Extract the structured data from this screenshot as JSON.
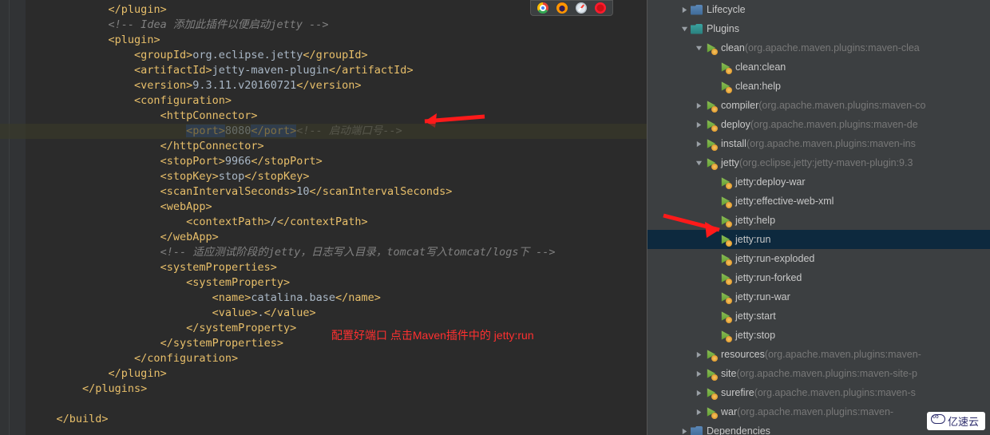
{
  "editor": {
    "highlight_line_index": 7,
    "lines": [
      {
        "indent": 3,
        "html": "<span class='tag'>&lt;/plugin&gt;</span>"
      },
      {
        "indent": 3,
        "html": "<span class='cmt'>&lt;!-- Idea 添加此插件以便启动jetty --&gt;</span>"
      },
      {
        "indent": 3,
        "html": "<span class='tag'>&lt;plugin&gt;</span>"
      },
      {
        "indent": 4,
        "html": "<span class='tag'>&lt;groupId&gt;</span><span class='val'>org.eclipse.jetty</span><span class='tag'>&lt;/groupId&gt;</span>"
      },
      {
        "indent": 4,
        "html": "<span class='tag'>&lt;artifactId&gt;</span><span class='val'>jetty-maven-plugin</span><span class='tag'>&lt;/artifactId&gt;</span>"
      },
      {
        "indent": 4,
        "html": "<span class='tag'>&lt;version&gt;</span><span class='val'>9.3.11.v20160721</span><span class='tag'>&lt;/version&gt;</span>"
      },
      {
        "indent": 4,
        "html": "<span class='tag'>&lt;configuration&gt;</span>"
      },
      {
        "indent": 5,
        "html": "<span class='tag'>&lt;httpConnector&gt;</span>"
      },
      {
        "indent": 6,
        "html": "<span class='sel'><span class='tag'>&lt;port&gt;</span></span><span class='val'>8080</span><span class='sel'><span class='tag'>&lt;/port&gt;</span></span><span class='cmt'>&lt;!-- 启动端口号--&gt;</span>",
        "caret": true
      },
      {
        "indent": 5,
        "html": "<span class='tag'>&lt;/httpConnector&gt;</span>"
      },
      {
        "indent": 5,
        "html": "<span class='tag'>&lt;stopPort&gt;</span><span class='val'>9966</span><span class='tag'>&lt;/stopPort&gt;</span>"
      },
      {
        "indent": 5,
        "html": "<span class='tag'>&lt;stopKey&gt;</span><span class='val'>stop</span><span class='tag'>&lt;/stopKey&gt;</span>"
      },
      {
        "indent": 5,
        "html": "<span class='tag'>&lt;scanIntervalSeconds&gt;</span><span class='val'>10</span><span class='tag'>&lt;/scanIntervalSeconds&gt;</span>"
      },
      {
        "indent": 5,
        "html": "<span class='tag'>&lt;webApp&gt;</span>"
      },
      {
        "indent": 6,
        "html": "<span class='tag'>&lt;contextPath&gt;</span><span class='val'>/</span><span class='tag'>&lt;/contextPath&gt;</span>"
      },
      {
        "indent": 5,
        "html": "<span class='tag'>&lt;/webApp&gt;</span>"
      },
      {
        "indent": 5,
        "html": "<span class='cmt'>&lt;!-- 适应测试阶段的jetty，日志写入目录，tomcat写入tomcat/logs下 --&gt;</span>"
      },
      {
        "indent": 5,
        "html": "<span class='tag'>&lt;systemProperties&gt;</span>"
      },
      {
        "indent": 6,
        "html": "<span class='tag'>&lt;systemProperty&gt;</span>"
      },
      {
        "indent": 7,
        "html": "<span class='tag'>&lt;name&gt;</span><span class='val'>catalina.base</span><span class='tag'>&lt;/name&gt;</span>"
      },
      {
        "indent": 7,
        "html": "<span class='tag'>&lt;value&gt;</span><span class='val'>.</span><span class='tag'>&lt;/value&gt;</span>"
      },
      {
        "indent": 6,
        "html": "<span class='tag'>&lt;/systemProperty&gt;</span>"
      },
      {
        "indent": 5,
        "html": "<span class='tag'>&lt;/systemProperties&gt;</span>"
      },
      {
        "indent": 4,
        "html": "<span class='tag'>&lt;/configuration&gt;</span>"
      },
      {
        "indent": 3,
        "html": "<span class='tag'>&lt;/plugin&gt;</span>"
      },
      {
        "indent": 2,
        "html": "<span class='tag'>&lt;/plugins&gt;</span>"
      },
      {
        "indent": 0,
        "html": ""
      },
      {
        "indent": 1,
        "html": "<span class='tag'>&lt;/build&gt;</span>"
      }
    ],
    "annotation_text": "配置好端口 点击Maven插件中的 jetty:run"
  },
  "browser_icons": [
    "chrome",
    "firefox",
    "safari",
    "opera"
  ],
  "maven": {
    "nodes": [
      {
        "depth": 2,
        "tw": "right",
        "icon": "folder",
        "label": "Lifecycle",
        "meta": ""
      },
      {
        "depth": 2,
        "tw": "down",
        "icon": "folderteal",
        "label": "Plugins",
        "meta": ""
      },
      {
        "depth": 3,
        "tw": "down",
        "icon": "run",
        "label": "clean",
        "meta": " (org.apache.maven.plugins:maven-clea"
      },
      {
        "depth": 4,
        "tw": "none",
        "icon": "run",
        "label": "clean:clean",
        "meta": ""
      },
      {
        "depth": 4,
        "tw": "none",
        "icon": "run",
        "label": "clean:help",
        "meta": ""
      },
      {
        "depth": 3,
        "tw": "right",
        "icon": "run",
        "label": "compiler",
        "meta": " (org.apache.maven.plugins:maven-co"
      },
      {
        "depth": 3,
        "tw": "right",
        "icon": "run",
        "label": "deploy",
        "meta": " (org.apache.maven.plugins:maven-de"
      },
      {
        "depth": 3,
        "tw": "right",
        "icon": "run",
        "label": "install",
        "meta": " (org.apache.maven.plugins:maven-ins"
      },
      {
        "depth": 3,
        "tw": "down",
        "icon": "run",
        "label": "jetty",
        "meta": " (org.eclipse.jetty:jetty-maven-plugin:9.3"
      },
      {
        "depth": 4,
        "tw": "none",
        "icon": "run",
        "label": "jetty:deploy-war",
        "meta": ""
      },
      {
        "depth": 4,
        "tw": "none",
        "icon": "run",
        "label": "jetty:effective-web-xml",
        "meta": ""
      },
      {
        "depth": 4,
        "tw": "none",
        "icon": "run",
        "label": "jetty:help",
        "meta": ""
      },
      {
        "depth": 4,
        "tw": "none",
        "icon": "run",
        "label": "jetty:run",
        "meta": "",
        "selected": true
      },
      {
        "depth": 4,
        "tw": "none",
        "icon": "run",
        "label": "jetty:run-exploded",
        "meta": ""
      },
      {
        "depth": 4,
        "tw": "none",
        "icon": "run",
        "label": "jetty:run-forked",
        "meta": ""
      },
      {
        "depth": 4,
        "tw": "none",
        "icon": "run",
        "label": "jetty:run-war",
        "meta": ""
      },
      {
        "depth": 4,
        "tw": "none",
        "icon": "run",
        "label": "jetty:start",
        "meta": ""
      },
      {
        "depth": 4,
        "tw": "none",
        "icon": "run",
        "label": "jetty:stop",
        "meta": ""
      },
      {
        "depth": 3,
        "tw": "right",
        "icon": "run",
        "label": "resources",
        "meta": " (org.apache.maven.plugins:maven-"
      },
      {
        "depth": 3,
        "tw": "right",
        "icon": "run",
        "label": "site",
        "meta": " (org.apache.maven.plugins:maven-site-p"
      },
      {
        "depth": 3,
        "tw": "right",
        "icon": "run",
        "label": "surefire",
        "meta": " (org.apache.maven.plugins:maven-s"
      },
      {
        "depth": 3,
        "tw": "right",
        "icon": "run",
        "label": "war",
        "meta": " (org.apache.maven.plugins:maven-"
      },
      {
        "depth": 2,
        "tw": "right",
        "icon": "folder",
        "label": "Dependencies",
        "meta": ""
      }
    ]
  },
  "watermark": "亿速云"
}
